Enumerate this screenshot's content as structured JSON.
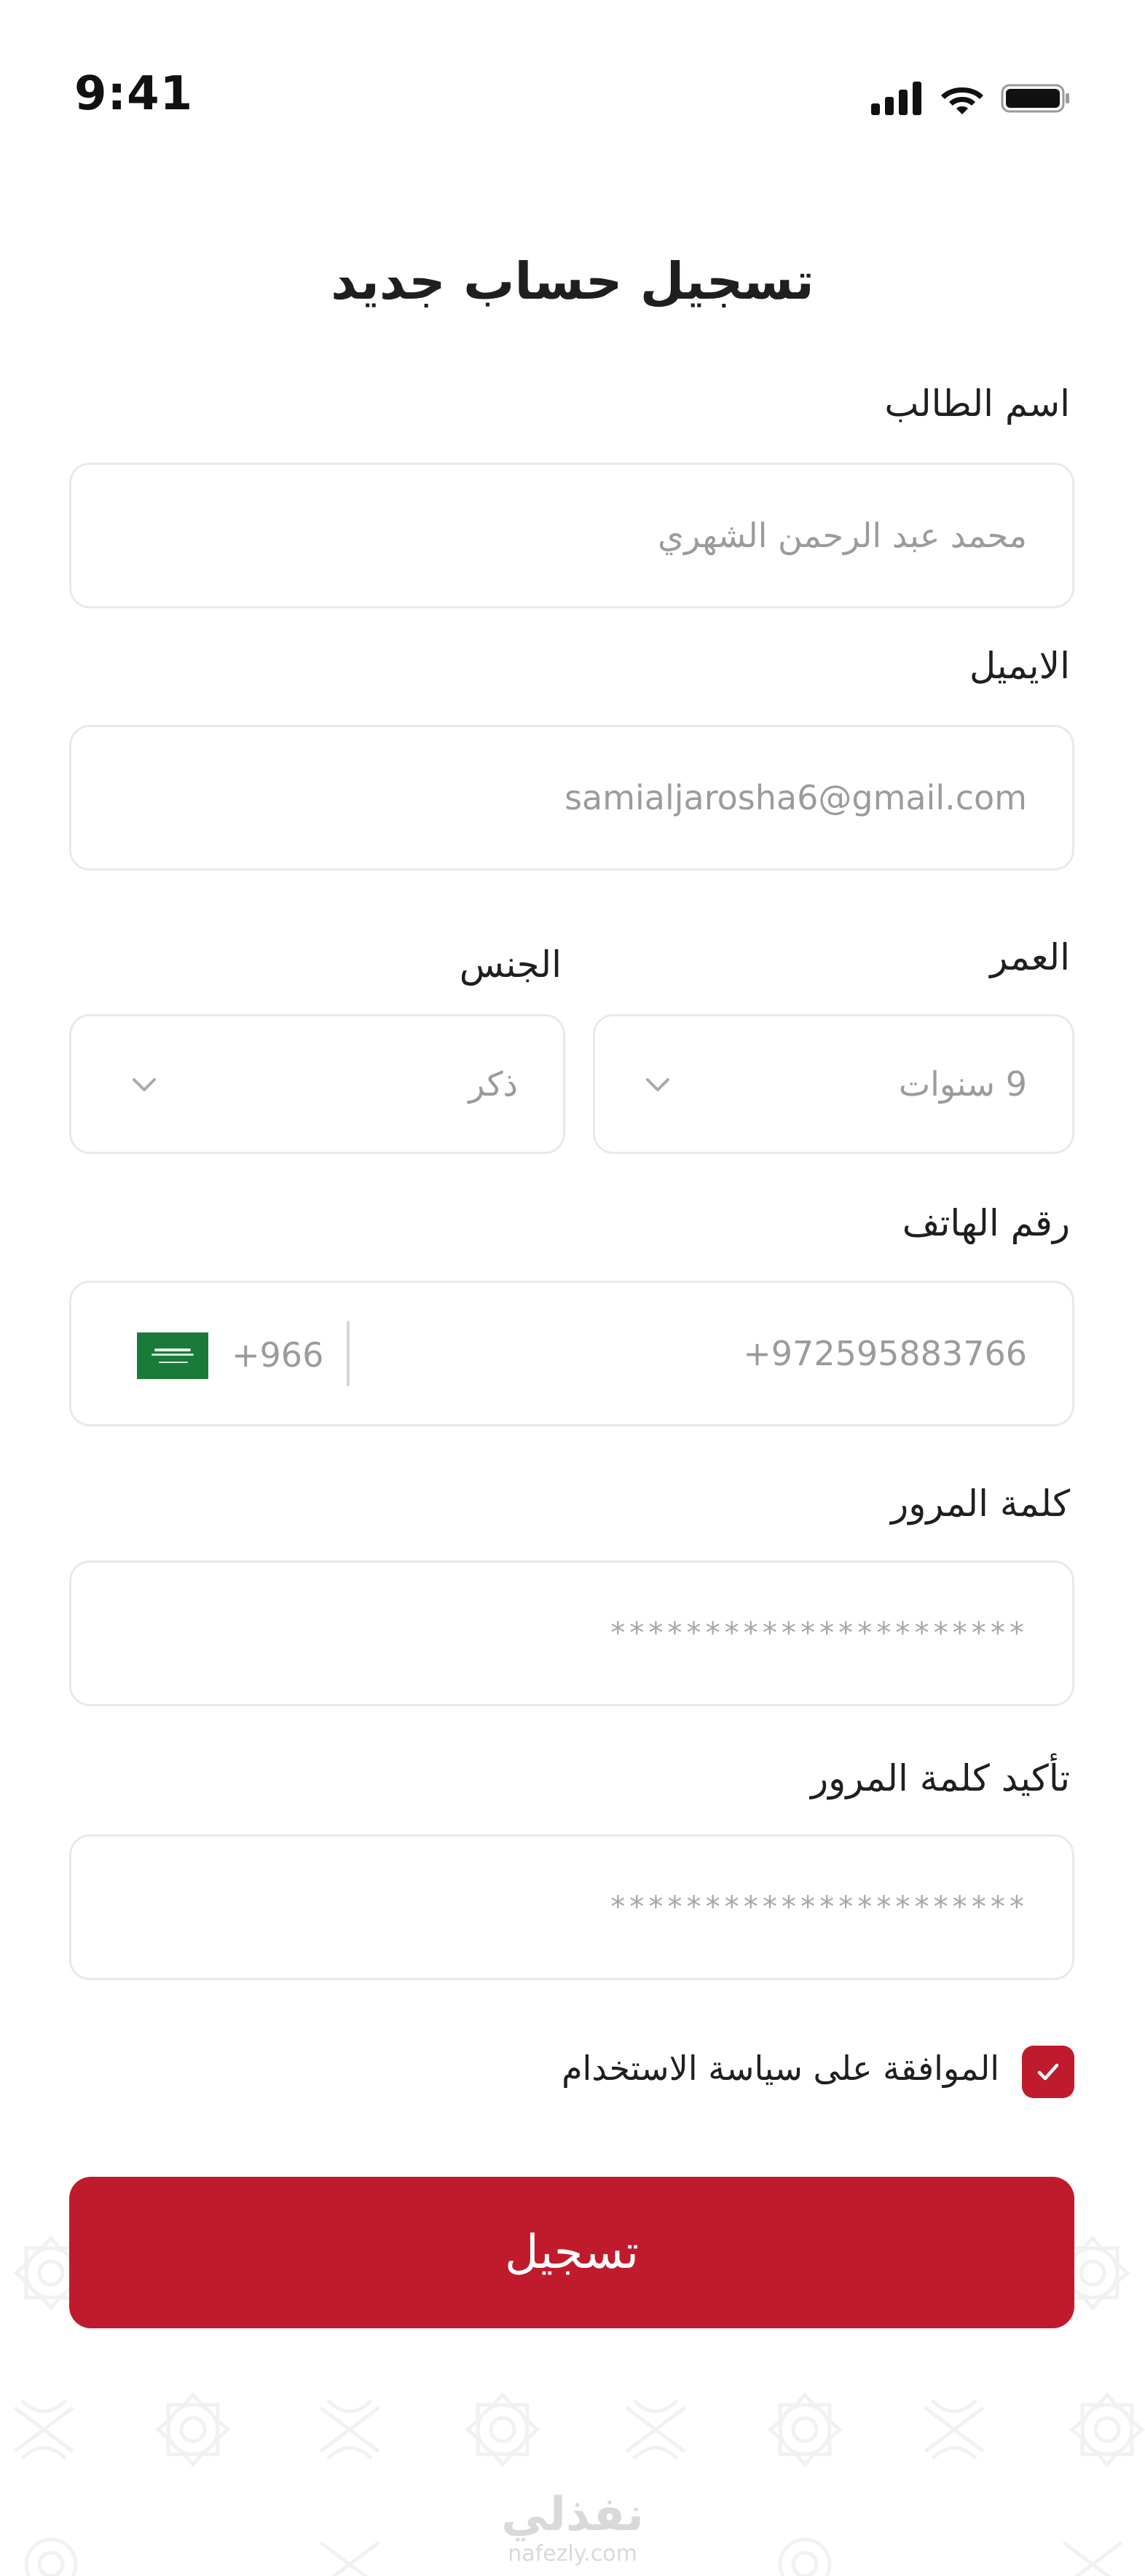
{
  "status_bar": {
    "time": "9:41",
    "icons": [
      "cellular-signal-icon",
      "wifi-icon",
      "battery-icon"
    ]
  },
  "title": "تسجيل حساب جديد",
  "form": {
    "student_name": {
      "label": "اسم الطالب",
      "placeholder": "محمد عبد الرحمن الشهري"
    },
    "email": {
      "label": "الايميل",
      "placeholder": "samialjarosha6@gmail.com"
    },
    "age": {
      "label": "العمر",
      "value": "9 سنوات"
    },
    "gender": {
      "label": "الجنس",
      "value": "ذكر"
    },
    "phone": {
      "label": "رقم الهاتف",
      "placeholder": "+972595883766",
      "country_code": "+966",
      "flag": "saudi-arabia-flag-icon"
    },
    "password": {
      "label": "كلمة المرور",
      "placeholder": "**********************"
    },
    "confirm_password": {
      "label": "تأكيد كلمة المرور",
      "placeholder": "**********************"
    },
    "agree": {
      "label": "الموافقة على سياسة الاستخدام",
      "checked": true
    },
    "submit_label": "تسجيل"
  },
  "watermark": {
    "arabic": "نفذلي",
    "latin": "nafezly.com"
  },
  "colors": {
    "accent": "#bf1b2c",
    "border": "#e9e9e9",
    "placeholder": "#9b9b9b",
    "text": "#1f1f1f"
  }
}
